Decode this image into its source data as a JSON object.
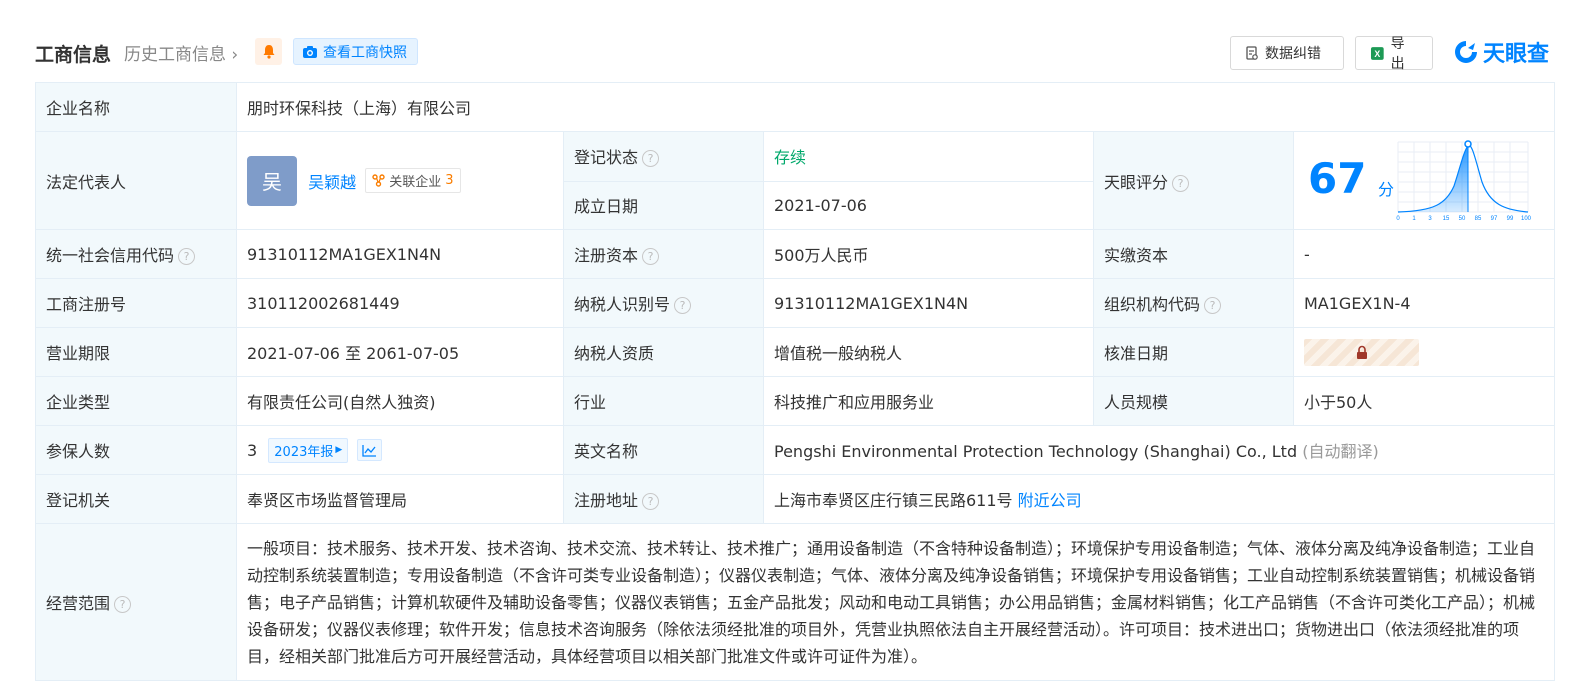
{
  "header": {
    "title": "工商信息",
    "history": "历史工商信息",
    "snapshot_label": "查看工商快照",
    "error_label": "数据纠错",
    "export_label": "导出",
    "brand": "天眼查"
  },
  "company": {
    "name_label": "企业名称",
    "name": "朋时环保科技（上海）有限公司",
    "legal_rep_label": "法定代表人",
    "legal_rep_avatar": "吴",
    "legal_rep": "吴颖越",
    "related_label": "关联企业",
    "related_count": "3",
    "status_label": "登记状态",
    "status": "存续",
    "founded_label": "成立日期",
    "founded": "2021-07-06",
    "score_label": "天眼评分",
    "score": "67",
    "score_unit": "分",
    "score_ticks": [
      "0",
      "1",
      "3",
      "15",
      "50",
      "85",
      "97",
      "99",
      "100"
    ],
    "credit_code_label": "统一社会信用代码",
    "credit_code": "91310112MA1GEX1N4N",
    "reg_capital_label": "注册资本",
    "reg_capital": "500万人民币",
    "paid_capital_label": "实缴资本",
    "paid_capital": "-",
    "reg_no_label": "工商注册号",
    "reg_no": "310112002681449",
    "taxpayer_id_label": "纳税人识别号",
    "taxpayer_id": "91310112MA1GEX1N4N",
    "org_code_label": "组织机构代码",
    "org_code": "MA1GEX1N-4",
    "term_label": "营业期限",
    "term": "2021-07-06 至 2061-07-05",
    "taxpayer_type_label": "纳税人资质",
    "taxpayer_type": "增值税一般纳税人",
    "approved_label": "核准日期",
    "type_label": "企业类型",
    "type": "有限责任公司(自然人独资)",
    "industry_label": "行业",
    "industry": "科技推广和应用服务业",
    "staff_label": "人员规模",
    "staff": "小于50人",
    "insured_label": "参保人数",
    "insured": "3",
    "insured_year": "2023年报",
    "en_name_label": "英文名称",
    "en_name": "Pengshi Environmental Protection Technology (Shanghai) Co., Ltd",
    "en_name_note": "(自动翻译)",
    "authority_label": "登记机关",
    "authority": "奉贤区市场监督管理局",
    "address_label": "注册地址",
    "address": "上海市奉贤区庄行镇三民路611号",
    "nearby_label": "附近公司",
    "scope_label": "经营范围",
    "scope": "一般项目：技术服务、技术开发、技术咨询、技术交流、技术转让、技术推广；通用设备制造（不含特种设备制造）；环境保护专用设备制造；气体、液体分离及纯净设备制造；工业自动控制系统装置制造；专用设备制造（不含许可类专业设备制造）；仪器仪表制造；气体、液体分离及纯净设备销售；环境保护专用设备销售；工业自动控制系统装置销售；机械设备销售；电子产品销售；计算机软硬件及辅助设备零售；仪器仪表销售；五金产品批发；风动和电动工具销售；办公用品销售；金属材料销售；化工产品销售（不含许可类化工产品）；机械设备研发；仪器仪表修理；软件开发；信息技术咨询服务（除依法须经批准的项目外，凭营业执照依法自主开展经营活动）。许可项目：技术进出口；货物进出口（依法须经批准的项目，经相关部门批准后方可开展经营活动，具体经营项目以相关部门批准文件或许可证件为准）。"
  },
  "icons": {
    "bell": "bell-icon",
    "camera": "camera-icon",
    "error": "doc-edit-icon",
    "excel": "excel-icon",
    "help": "question-circle-icon",
    "lock": "lock-icon",
    "trend": "trend-chart-icon"
  },
  "colors": {
    "accent": "#0084ff",
    "status_ok": "#00a86b",
    "label_bg": "#f2f9fc",
    "orange": "#fa7d00"
  }
}
